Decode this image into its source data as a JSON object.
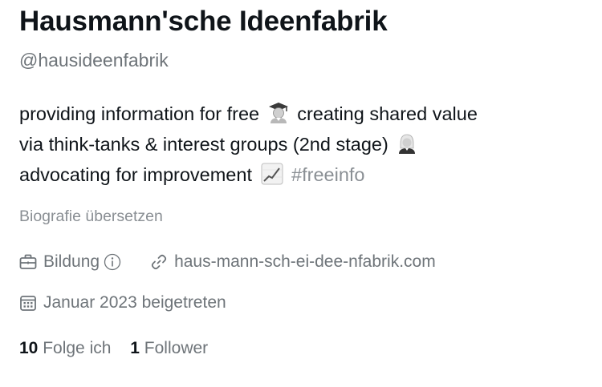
{
  "profile": {
    "display_name": "Hausmann'sche Ideenfabrik",
    "handle": "@hausideenfabrik",
    "bio": {
      "line1_a": "providing information for free",
      "line1_b": "creating shared value",
      "line2_a": "via think-tanks & interest groups (2nd stage)",
      "line3_a": "advocating for improvement",
      "hashtag": "#freeinfo"
    },
    "translate_label": "Biografie übersetzen",
    "category": "Bildung",
    "website": "haus-mann-sch-ei-dee-nfabrik.com",
    "joined": "Januar 2023 beigetreten",
    "following_count": "10",
    "following_label": "Folge ich",
    "followers_count": "1",
    "followers_label": "Follower"
  },
  "icons": {
    "graduate_emoji": "student-emoji-icon",
    "judge_emoji": "judge-emoji-icon",
    "chart_emoji": "chart-increasing-emoji-icon",
    "category": "briefcase-icon",
    "info": "info-circle-icon",
    "link": "link-icon",
    "calendar": "calendar-icon"
  },
  "colors": {
    "text_primary": "#0f1419",
    "text_secondary": "#6e7479",
    "hashtag": "#8a8f94",
    "background": "#ffffff"
  }
}
